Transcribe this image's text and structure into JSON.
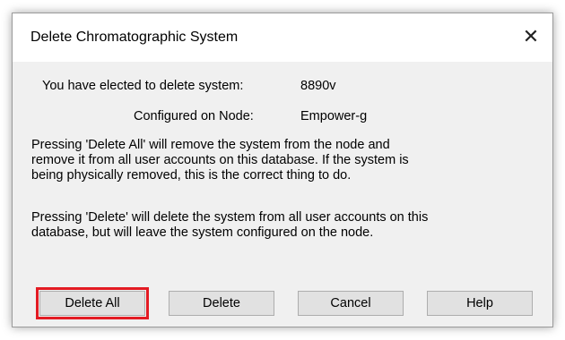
{
  "dialog": {
    "title": "Delete Chromatographic System",
    "close_glyph": "✕",
    "system_label": "You have elected to delete system:",
    "system_value": "8890v",
    "node_label": "Configured on Node:",
    "node_value": "Empower-g",
    "paragraph1": "Pressing 'Delete All' will remove the system from the node and\nremove it from all user accounts on this database.  If the system is\nbeing physically removed, this is the correct thing to do.",
    "paragraph2": "Pressing 'Delete' will delete the system from all user accounts on this\ndatabase, but will leave the system configured on the node."
  },
  "buttons": {
    "delete_all": "Delete All",
    "delete": "Delete",
    "cancel": "Cancel",
    "help": "Help"
  },
  "colors": {
    "highlight": "#e31b23",
    "dialog_bg": "#f0f0f0",
    "button_bg": "#e1e1e1"
  }
}
